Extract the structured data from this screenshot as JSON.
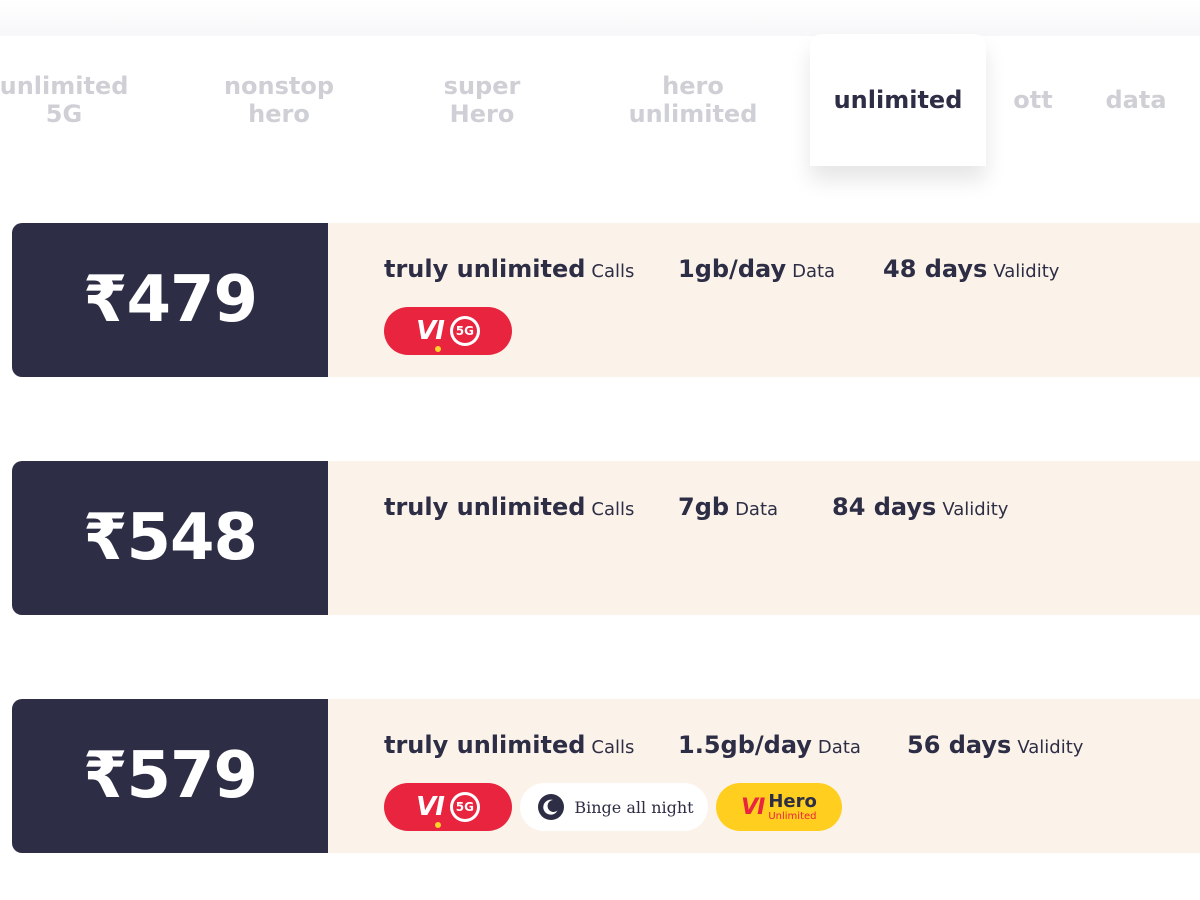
{
  "tabs": [
    {
      "label": "unlimited\n5G",
      "active": false
    },
    {
      "label": "nonstop\nhero",
      "active": false
    },
    {
      "label": "super\nHero",
      "active": false
    },
    {
      "label": "hero\nunlimited",
      "active": false
    },
    {
      "label": "unlimited",
      "active": true
    },
    {
      "label": "ott",
      "active": false
    },
    {
      "label": "data",
      "active": false
    }
  ],
  "plans": [
    {
      "price": "₹479",
      "calls_value": "truly unlimited",
      "calls_label": "Calls",
      "data_value": "1gb/day",
      "data_label": "Data",
      "validity_value": "48 days",
      "validity_label": "Validity",
      "badges": [
        "vi-5g"
      ]
    },
    {
      "price": "₹548",
      "calls_value": "truly unlimited",
      "calls_label": "Calls",
      "data_value": "7gb",
      "data_label": "Data",
      "validity_value": "84 days",
      "validity_label": "Validity",
      "badges": []
    },
    {
      "price": "₹579",
      "calls_value": "truly unlimited",
      "calls_label": "Calls",
      "data_value": "1.5gb/day",
      "data_label": "Data",
      "validity_value": "56 days",
      "validity_label": "Validity",
      "badges": [
        "vi-5g",
        "binge-all-night",
        "vi-hero-unlimited"
      ]
    }
  ],
  "badges": {
    "vi_text": "VI",
    "fiveg_text": "5G",
    "binge_text": "Binge all night",
    "hero_vi_text": "VI",
    "hero_word": "Hero",
    "hero_sub": "Unlimited"
  },
  "colors": {
    "dark": "#2d2e45",
    "cream": "#fbf3ea",
    "vi_red": "#e8243e",
    "hero_yellow": "#ffce1f",
    "inactive_tab": "#cfd0d6"
  },
  "icons": {
    "moon": "moon-icon"
  }
}
